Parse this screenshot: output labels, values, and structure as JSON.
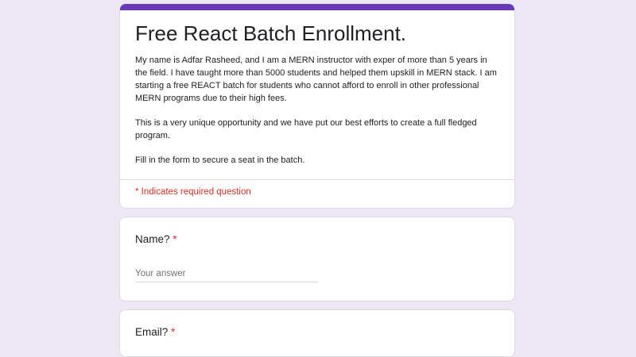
{
  "form": {
    "title": "Free React Batch Enrollment.",
    "description": [
      "My name is Adfar Rasheed, and I am a MERN instructor with exper of more than 5 years in the field. I have taught more than 5000 students and helped them upskill in MERN stack. I am starting a free REACT batch for students who cannot afford to enroll in other professional MERN programs due to their high fees.",
      "This is a very unique opportunity and we have put our best efforts to create a full fledged program.",
      "Fill in the form to secure a seat in the batch."
    ],
    "required_note": "* Indicates required question"
  },
  "questions": [
    {
      "label": "Name?",
      "required_mark": "*",
      "placeholder": "Your answer"
    },
    {
      "label": "Email?",
      "required_mark": "*"
    }
  ],
  "colors": {
    "accent": "#673ab7",
    "background": "#ede7f6",
    "required": "#d93025"
  }
}
